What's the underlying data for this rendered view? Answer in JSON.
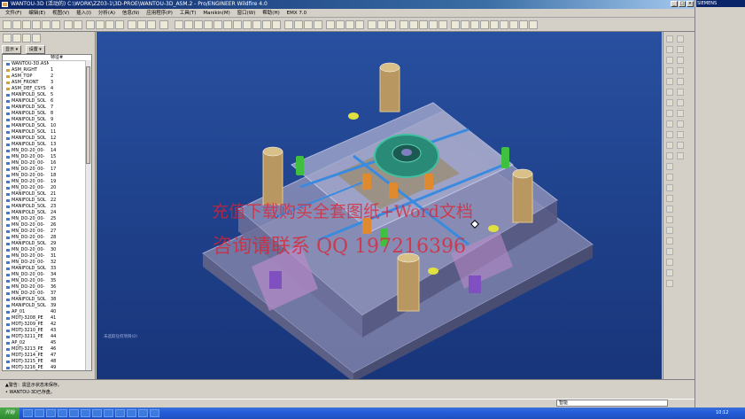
{
  "window": {
    "title": "WANTOU-3D (活动的) C:\\WORK\\ZZ03-1\\3D-PROE\\WANTOU-3D_ASM.2 - Pro/ENGINEER Wildfire 4.0"
  },
  "menu": [
    "文件(F)",
    "编辑(E)",
    "视图(V)",
    "插入(I)",
    "分析(A)",
    "信息(N)",
    "应用程序(P)",
    "工具(T)",
    "Manikin(M)",
    "窗口(W)",
    "帮助(H)",
    "EMX 7.0"
  ],
  "left_panel": {
    "show_button": "显示 ▾",
    "settings_button": "设置 ▾",
    "column_header": "特征#",
    "tree_items": [
      {
        "name": "WANTOU-3D.ASM",
        "num": ""
      },
      {
        "name": "ASM_RIGHT",
        "num": "1"
      },
      {
        "name": "ASM_TOP",
        "num": "2"
      },
      {
        "name": "ASM_FRONT",
        "num": "3"
      },
      {
        "name": "ASM_DEF_CSYS",
        "num": "4"
      },
      {
        "name": "MANIFOLD_SOL",
        "num": "5"
      },
      {
        "name": "MANIFOLD_SOL",
        "num": "6"
      },
      {
        "name": "MANIFOLD_SOL",
        "num": "7"
      },
      {
        "name": "MANIFOLD_SOL",
        "num": "8"
      },
      {
        "name": "MANIFOLD_SOL",
        "num": "9"
      },
      {
        "name": "MANIFOLD_SOL",
        "num": "10"
      },
      {
        "name": "MANIFOLD_SOL",
        "num": "11"
      },
      {
        "name": "MANIFOLD_SOL",
        "num": "12"
      },
      {
        "name": "MANIFOLD_SOL",
        "num": "13"
      },
      {
        "name": "MN_DO-20_00-",
        "num": "14"
      },
      {
        "name": "MN_DO-20_00-",
        "num": "15"
      },
      {
        "name": "MN_DO-20_00-",
        "num": "16"
      },
      {
        "name": "MN_DO-20_00-",
        "num": "17"
      },
      {
        "name": "MN_DO-20_00-",
        "num": "18"
      },
      {
        "name": "MN_DO-20_00-",
        "num": "19"
      },
      {
        "name": "MN_DO-20_00-",
        "num": "20"
      },
      {
        "name": "MANIFOLD_SOL",
        "num": "21"
      },
      {
        "name": "MANIFOLD_SOL",
        "num": "22"
      },
      {
        "name": "MANIFOLD_SOL",
        "num": "23"
      },
      {
        "name": "MANIFOLD_SOL",
        "num": "24"
      },
      {
        "name": "MN_DO-20_00-",
        "num": "25"
      },
      {
        "name": "MN_DO-20_00-",
        "num": "26"
      },
      {
        "name": "MN_DO-20_00-",
        "num": "27"
      },
      {
        "name": "MN_DO-20_00-",
        "num": "28"
      },
      {
        "name": "MANIFOLD_SOL",
        "num": "29"
      },
      {
        "name": "MN_DO-20_00-",
        "num": "30"
      },
      {
        "name": "MN_DO-20_00-",
        "num": "31"
      },
      {
        "name": "MN_DO-20_00-",
        "num": "32"
      },
      {
        "name": "MANIFOLD_SOL",
        "num": "33"
      },
      {
        "name": "MN_DO-20_00-",
        "num": "34"
      },
      {
        "name": "MN_DO-20_00-",
        "num": "35"
      },
      {
        "name": "MN_DO-20_00-",
        "num": "36"
      },
      {
        "name": "MN_DO-20_00-",
        "num": "37"
      },
      {
        "name": "MANIFOLD_SOL",
        "num": "38"
      },
      {
        "name": "MANIFOLD_SOL",
        "num": "39"
      },
      {
        "name": "AP_01",
        "num": "40"
      },
      {
        "name": "MDTJ-3208_PE",
        "num": "41"
      },
      {
        "name": "MDTJ-3209_PE",
        "num": "42"
      },
      {
        "name": "MDTJ-3210_PE",
        "num": "43"
      },
      {
        "name": "MDTJ-3211_PE",
        "num": "44"
      },
      {
        "name": "AP_02",
        "num": "45"
      },
      {
        "name": "MDTJ-3213_PE",
        "num": "46"
      },
      {
        "name": "MDTJ-3214_PE",
        "num": "47"
      },
      {
        "name": "MDTJ-3215_PE",
        "num": "48"
      },
      {
        "name": "MDTJ-3216_PE",
        "num": "49"
      }
    ]
  },
  "viewport": {
    "watermark_line1": "充值下载购买全套图纸+Word文档",
    "watermark_line2": "咨询请联系 QQ 197216396",
    "status_message": "未选取任何项目(0)"
  },
  "messages": {
    "line1": "▲警告：需显示状态未保存。",
    "line2": "• WANTOU-3D已存盘。"
  },
  "status": {
    "filter": "智能"
  },
  "siemens": {
    "title": "SIEMENS"
  },
  "taskbar": {
    "start": "开始",
    "clock": "10:12"
  },
  "colors": {
    "viewport_bg": "#1f3e82",
    "titlebar": "#0a246a",
    "watermark": "#e02030"
  }
}
